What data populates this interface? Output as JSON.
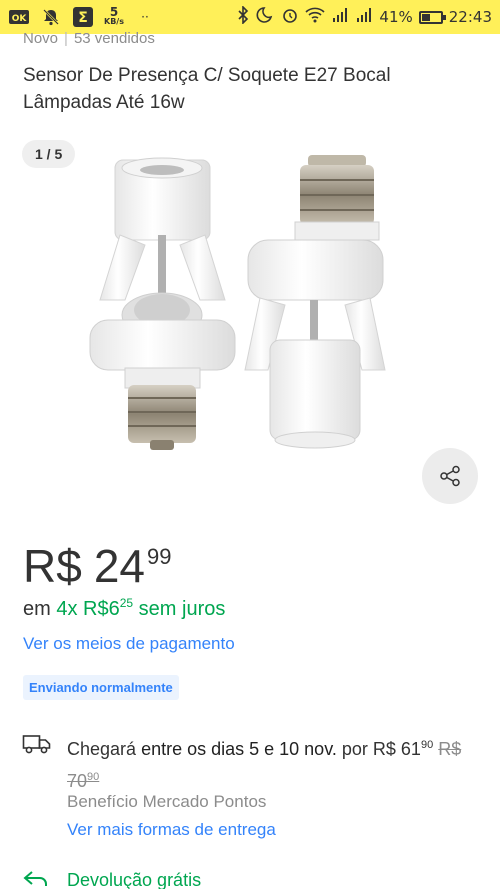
{
  "status_bar": {
    "left_icons": [
      "ok-icon",
      "notification-muted-icon",
      "sigma-app-icon"
    ],
    "netspeed_value": "5",
    "netspeed_unit": "KB/s",
    "battery_percent": "41%",
    "battery_level": 0.41,
    "time": "22:43",
    "bg_color": "#fff059"
  },
  "product": {
    "condition": "Novo",
    "sold": "53 vendidos",
    "title": "Sensor De Presença C/ Soquete E27 Bocal Lâmpadas Até 16w",
    "image_counter": "1 / 5"
  },
  "price": {
    "currency": "R$",
    "integer": "24",
    "cents": "99"
  },
  "installments": {
    "prefix": "em",
    "count": "4x",
    "currency": "R$",
    "integer": "6",
    "cents": "25",
    "suffix": "sem juros",
    "accent_color": "#00a650"
  },
  "payment_link": "Ver os meios de pagamento",
  "shipping_badge": "Enviando normalmente",
  "delivery": {
    "prefix": "Chegará",
    "dates": "entre os dias 5 e 10 nov.",
    "por": "por",
    "price_int": "R$ 61",
    "price_cents": "90",
    "old_price_int": "R$ 70",
    "old_price_cents": "90",
    "benefit": "Benefício Mercado Pontos",
    "more_link": "Ver mais formas de entrega"
  },
  "returns": {
    "label": "Devolução grátis"
  },
  "colors": {
    "link": "#3483fa",
    "green": "#00a650",
    "badge_bg": "#ebf3fe"
  }
}
